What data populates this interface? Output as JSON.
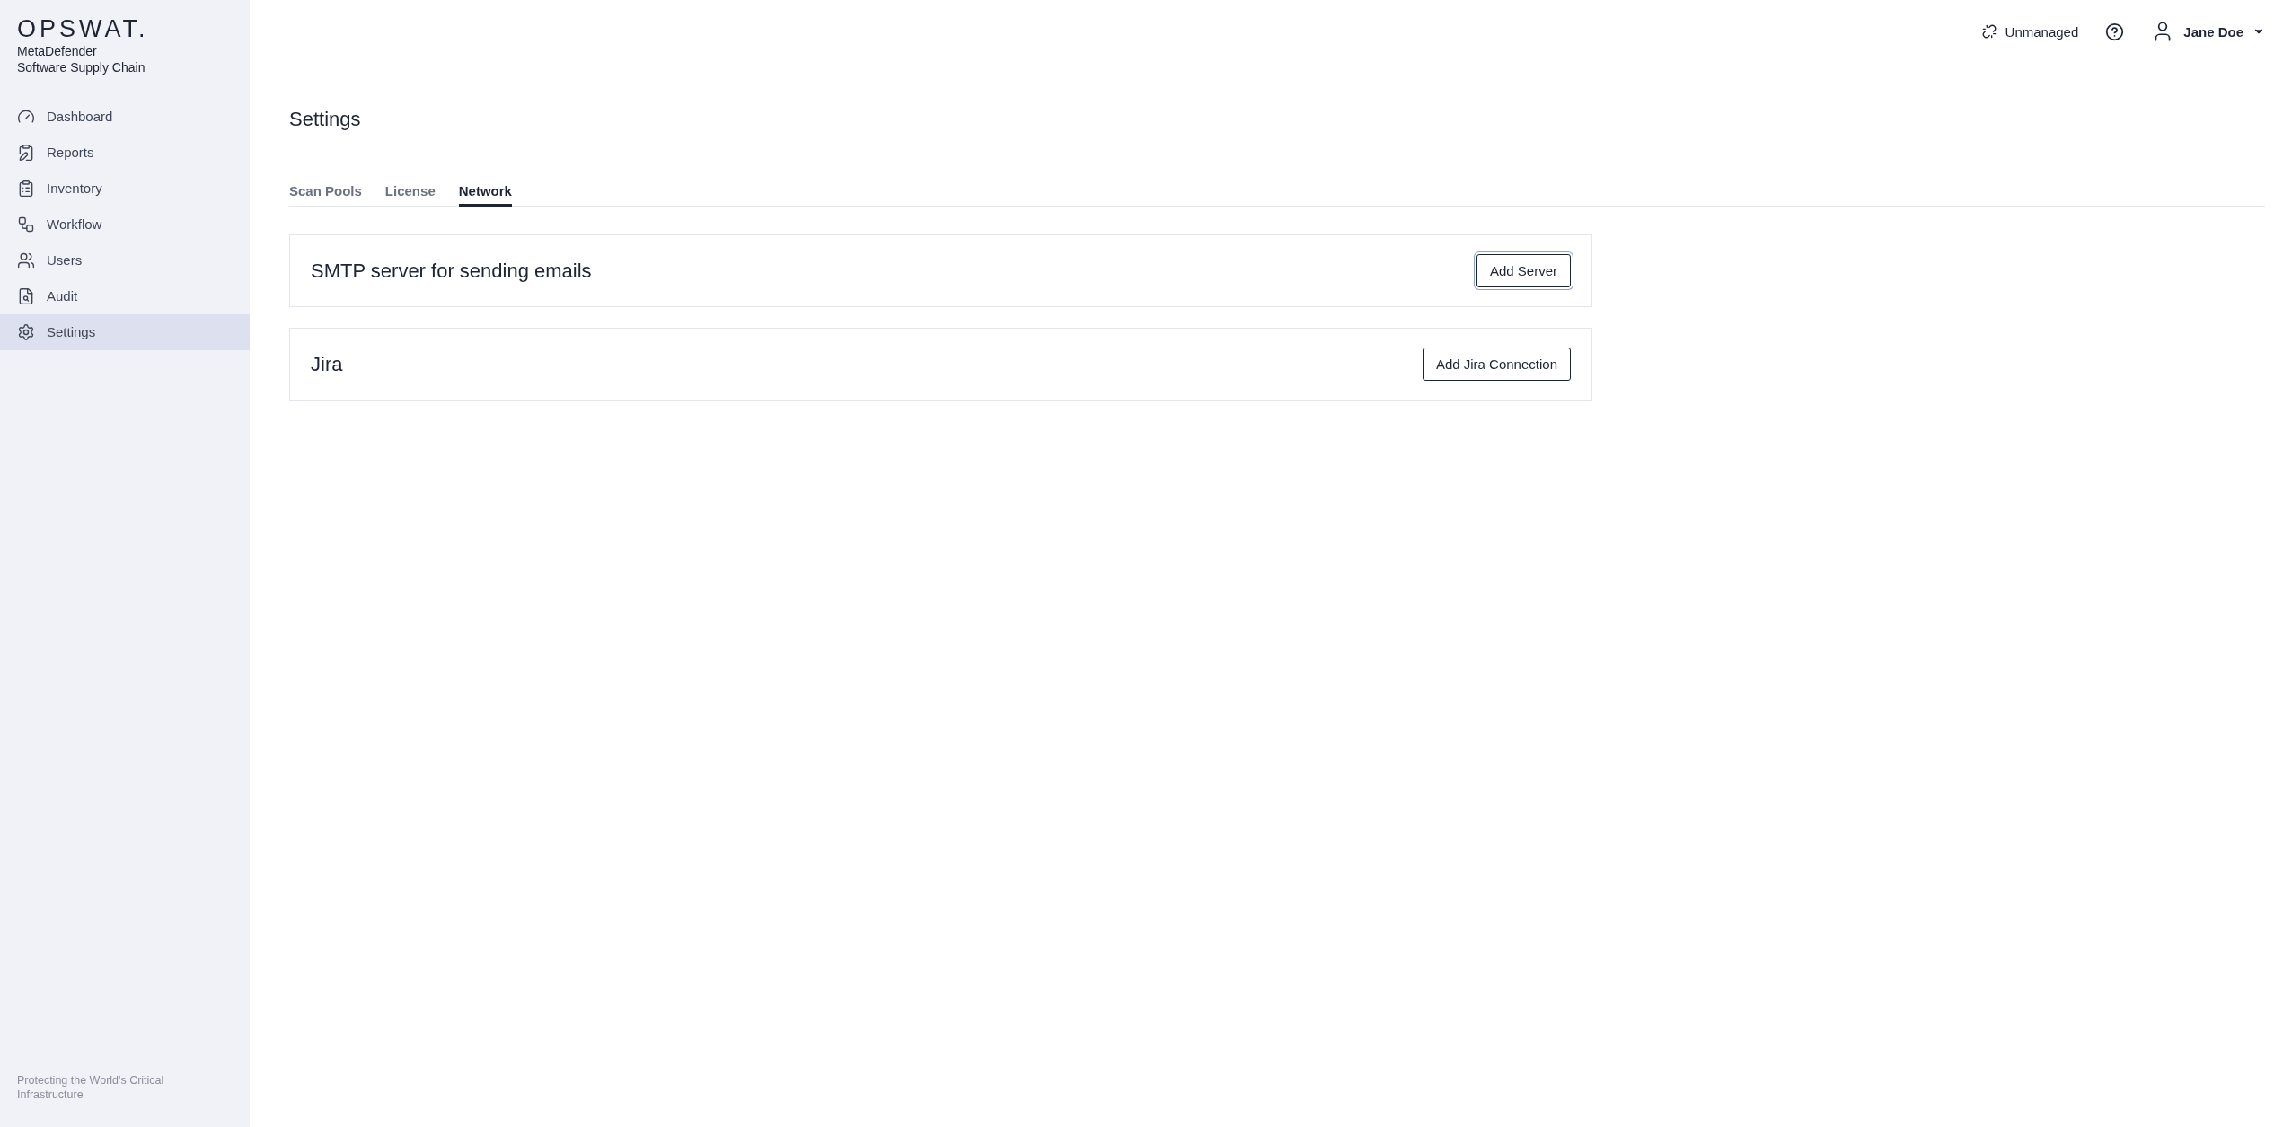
{
  "brand": {
    "logo": "OPSWAT.",
    "product_line": "MetaDefender",
    "product": "Software Supply Chain"
  },
  "sidebar": {
    "items": [
      {
        "label": "Dashboard",
        "selected": false
      },
      {
        "label": "Reports",
        "selected": false
      },
      {
        "label": "Inventory",
        "selected": false
      },
      {
        "label": "Workflow",
        "selected": false
      },
      {
        "label": "Users",
        "selected": false
      },
      {
        "label": "Audit",
        "selected": false
      },
      {
        "label": "Settings",
        "selected": true
      }
    ],
    "footer": "Protecting the World's Critical Infrastructure"
  },
  "header": {
    "status": "Unmanaged",
    "user": "Jane Doe"
  },
  "page": {
    "title": "Settings",
    "tabs": [
      {
        "label": "Scan Pools",
        "selected": false
      },
      {
        "label": "License",
        "selected": false
      },
      {
        "label": "Network",
        "selected": true
      }
    ],
    "sections": [
      {
        "title": "SMTP server for sending emails",
        "button": "Add Server",
        "focused": true
      },
      {
        "title": "Jira",
        "button": "Add Jira Connection",
        "focused": false
      }
    ]
  }
}
